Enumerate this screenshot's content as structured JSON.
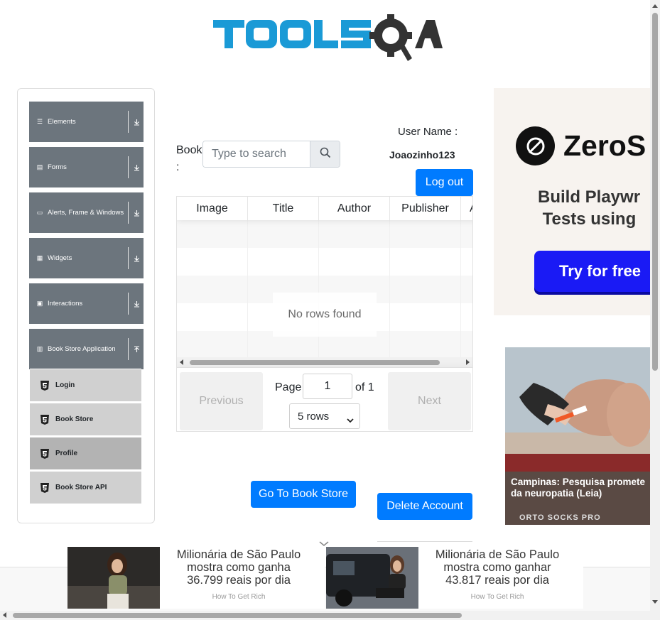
{
  "header": {
    "logo_text": "TOOLSQA"
  },
  "sidebar": {
    "groups": [
      {
        "label": "Elements",
        "icon": "list-icon"
      },
      {
        "label": "Forms",
        "icon": "file-icon"
      },
      {
        "label": "Alerts, Frame & Windows",
        "icon": "window-icon"
      },
      {
        "label": "Widgets",
        "icon": "grid-icon"
      },
      {
        "label": "Interactions",
        "icon": "square-icon"
      },
      {
        "label": "Book Store Application",
        "icon": "books-icon"
      }
    ],
    "items": [
      {
        "label": "Login",
        "icon": "html5-icon"
      },
      {
        "label": "Book Store",
        "icon": "html5-icon"
      },
      {
        "label": "Profile",
        "icon": "html5-icon",
        "active": true
      },
      {
        "label": "Book Store API",
        "icon": "html5-icon"
      }
    ]
  },
  "main": {
    "book_label": "Book :",
    "search_placeholder": "Type to search",
    "username_label": "User Name :",
    "username_value": "Joaozinho123",
    "logout_label": "Log out",
    "table": {
      "columns": [
        "Image",
        "Title",
        "Author",
        "Publisher",
        "Act"
      ],
      "empty_text": "No rows found"
    },
    "pagination": {
      "previous": "Previous",
      "next": "Next",
      "page_label": "Page",
      "page_value": "1",
      "of_label": "of 1",
      "rows_option": "5 rows"
    },
    "goto_store_label": "Go To Book Store",
    "delete_account_label": "Delete Account"
  },
  "ads": {
    "right_top": {
      "brand": "ZeroS",
      "headline": "Build Playwr\n Tests using",
      "cta": "Try for free"
    },
    "right_bottom": {
      "caption": "Campinas: Pesquisa promete\nda neuropatia (Leia)",
      "source": "ORTO SOCKS PRO"
    },
    "bottom": [
      {
        "text": "Milionária de São Paulo\nmostra como ganha\n36.799 reais por dia",
        "source": "How To Get Rich"
      },
      {
        "text": "Milionária de São Paulo\nmostra como ganhar\n43.817 reais por dia",
        "source": "How To Get Rich"
      }
    ]
  },
  "colors": {
    "primary": "#007bff",
    "menu_header": "#6c757d",
    "menu_item": "#d0d0d0",
    "menu_item_active": "#b3b3b3",
    "logo_blue": "#1a9ad6",
    "logo_dark": "#333333"
  }
}
